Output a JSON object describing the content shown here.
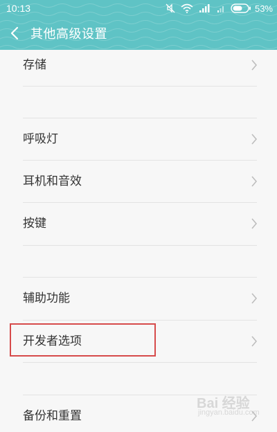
{
  "status_bar": {
    "time": "10:13",
    "battery_percent": "53%"
  },
  "title_bar": {
    "title": "其他高级设置"
  },
  "settings": {
    "items": [
      {
        "label": "存储"
      },
      {
        "label": "呼吸灯"
      },
      {
        "label": "耳机和音效"
      },
      {
        "label": "按键"
      },
      {
        "label": "辅助功能"
      },
      {
        "label": "开发者选项"
      },
      {
        "label": "备份和重置"
      }
    ]
  },
  "watermark": {
    "text": "Bai 经验",
    "sub": "jingyan.baidu.com"
  },
  "colors": {
    "header": "#5fc3c5",
    "background": "#f7f7f7",
    "highlight": "#d64a4a"
  },
  "icons": {
    "back": "chevron-left-icon",
    "chevron": "chevron-right-icon",
    "mute": "mute-icon",
    "wifi": "wifi-icon",
    "signal": "signal-icon",
    "battery": "battery-icon"
  }
}
